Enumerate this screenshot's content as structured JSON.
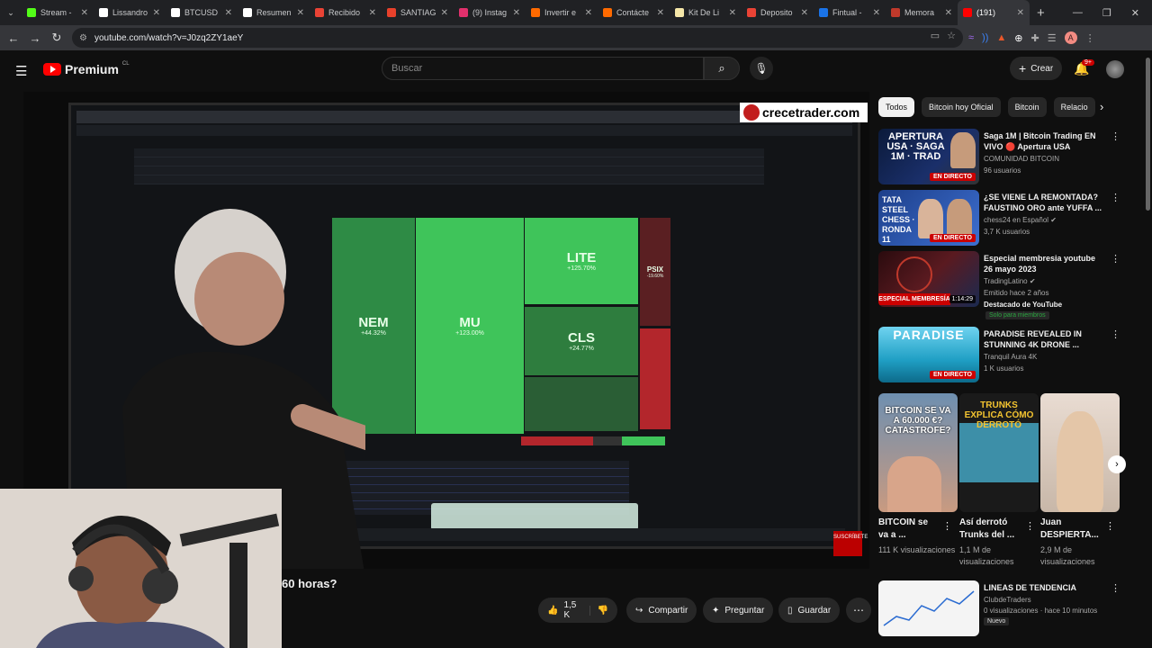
{
  "browser": {
    "tabs": [
      {
        "label": "Stream -",
        "color": "#53fc18"
      },
      {
        "label": "Lissandro",
        "color": "#ffffff"
      },
      {
        "label": "BTCUSD",
        "color": "#ffffff"
      },
      {
        "label": "Resumen",
        "color": "#ffffff"
      },
      {
        "label": "Recibido",
        "color": "#ea4335"
      },
      {
        "label": "SANTIAG",
        "color": "#e8412b"
      },
      {
        "label": "(9) Instag",
        "color": "#e1306c"
      },
      {
        "label": "Invertir e",
        "color": "#ff6a00"
      },
      {
        "label": "Contácte",
        "color": "#ff6a00"
      },
      {
        "label": "Kit De Li",
        "color": "#f5e6a8"
      },
      {
        "label": "Deposito",
        "color": "#ea4335"
      },
      {
        "label": "Fintual -",
        "color": "#1a73e8"
      },
      {
        "label": "Memora",
        "color": "#c0392b"
      },
      {
        "label": "(191)",
        "color": "#ff0000"
      }
    ],
    "url": "youtube.com/watch?v=J0zq2ZY1aeY"
  },
  "youtube": {
    "logo_text": "Premium",
    "country": "CL",
    "search_placeholder": "Buscar",
    "create_label": "Crear",
    "notifications": "9+"
  },
  "video": {
    "watermark": "crecetrader.com",
    "title_fragment": "60 horas?",
    "heatmap": [
      {
        "ticker": "NEM",
        "pct": "+44.32%"
      },
      {
        "ticker": "MU",
        "pct": "+123.00%"
      },
      {
        "ticker": "LITE",
        "pct": "+125.70%"
      },
      {
        "ticker": "CLS",
        "pct": "+24.77%"
      },
      {
        "ticker": "PSIX",
        "pct": "-19.60%"
      }
    ],
    "subscribe": "SUSCRÍBETE"
  },
  "actions": {
    "likes": "1,5 K",
    "share": "Compartir",
    "ask": "Preguntar",
    "save": "Guardar"
  },
  "chips": [
    "Todos",
    "Bitcoin hoy Oficial",
    "Bitcoin",
    "Relacio"
  ],
  "recommendations": [
    {
      "title": "Saga 1M | Bitcoin Trading EN VIVO 🔴 Apertura USA",
      "channel": "COMUNIDAD BITCOIN",
      "views": "96 usuarios",
      "badge": "EN DIRECTO",
      "thumb_text": "APERTURA USA · SAGA 1M · TRAD"
    },
    {
      "title": "¿SE VIENE LA REMONTADA? FAUSTINO ORO ante YUFFA ...",
      "channel": "chess24 en Español",
      "views": "3,7 K usuarios",
      "badge": "EN DIRECTO",
      "thumb_text": "TATA STEEL CHESS · RONDA 11"
    },
    {
      "title": "Especial membresia youtube 26 mayo 2023",
      "channel": "TradingLatino",
      "views": "Emitido hace 2 años",
      "extra": "Destacado de YouTube",
      "members": "Solo para miembros",
      "duration": "1:14:29",
      "thumb_text": "ESPECIAL MEMBRESÍA"
    },
    {
      "title": "PARADISE REVEALED IN STUNNING 4K DRONE ...",
      "channel": "Tranquil Aura 4K",
      "views": "1 K usuarios",
      "badge": "EN DIRECTO",
      "thumb_text": "PARADISE"
    }
  ],
  "shorts": [
    {
      "title": "BITCOIN se va a ...",
      "views": "111 K visualizaciones",
      "thumb_text": "BITCOIN SE VA A 60.000 €? CATASTROFE?"
    },
    {
      "title": "Así derrotó Trunks del ...",
      "views": "1,1 M de visualizaciones",
      "thumb_text": "TRUNKS EXPLICA CÓMO DERROTÓ"
    },
    {
      "title": "Juan DESPIERTA...",
      "views": "2,9 M de visualizaciones",
      "thumb_text": ""
    }
  ],
  "bottom_rec": {
    "title": "LINEAS DE TENDENCIA",
    "channel": "ClubdeTraders",
    "views": "0 visualizaciones · hace 10 minutos",
    "badge": "Nuevo"
  }
}
